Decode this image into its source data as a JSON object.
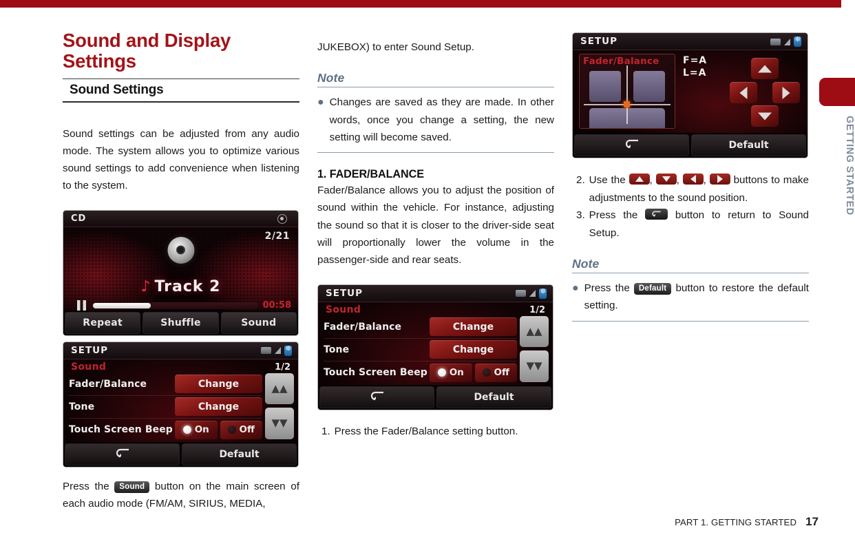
{
  "topbar": {
    "color": "#9e0c14"
  },
  "side_tab": {
    "label": "GETTING STARTED",
    "color": "#9e0c14",
    "text_color": "#7e8d9e"
  },
  "footer": {
    "text": "PART 1. GETTING STARTED",
    "page": "17"
  },
  "column1": {
    "chapter_title": "Sound and Display Settings",
    "section_title": "Sound Settings",
    "intro": "Sound settings can be adjusted from any audio mode. The system allows you to optimize various sound settings to add convenience when listening to the system.",
    "caption_before_key": "Press the",
    "caption_key": "Sound",
    "caption_after_key": "button on the main screen of each audio mode (FM/AM, SIRIUS, MEDIA,"
  },
  "column2": {
    "continued_text": "JUKEBOX) to enter Sound Setup.",
    "note_heading": "Note",
    "note_text": "Changes are saved as they are made. In other words, once you change a setting, the new setting will become saved.",
    "subhead": "1. FADER/BALANCE",
    "body": "Fader/Balance allows you to adjust the position of sound within the vehicle. For instance, adjusting the sound so that it is closer to the driver-side seat will proportionally lower the volume in the passenger-side and rear seats.",
    "step1_num": "1.",
    "step1_text": "Press the Fader/Balance setting button."
  },
  "column3": {
    "step2_num": "2.",
    "step2_prefix": "Use the",
    "step2_suffix": "buttons to make adjustments to the sound position.",
    "step3_num": "3.",
    "step3_prefix": "Press the",
    "step3_suffix": "button to return to Sound Setup.",
    "note_heading": "Note",
    "note_prefix": "Press the",
    "note_key": "Default",
    "note_suffix": "button to restore the default setting."
  },
  "screens": {
    "cd_player": {
      "source_label": "CD",
      "track_count": "2/21",
      "track_title": "Track  2",
      "elapsed_time": "00:58",
      "buttons": [
        "Repeat",
        "Shuffle",
        "Sound"
      ]
    },
    "setup_sound": {
      "title": "SETUP",
      "subtitle": "Sound",
      "page_indicator": "1/2",
      "rows": [
        {
          "label": "Fader/Balance",
          "action": "Change"
        },
        {
          "label": "Tone",
          "action": "Change"
        }
      ],
      "beep_label": "Touch Screen Beep",
      "beep_on": "On",
      "beep_off": "Off",
      "footer_default": "Default"
    },
    "fader_balance": {
      "title": "SETUP",
      "panel_title": "Fader/Balance",
      "fader_value": "F=A",
      "balance_value": "L=A",
      "footer_default": "Default"
    }
  }
}
